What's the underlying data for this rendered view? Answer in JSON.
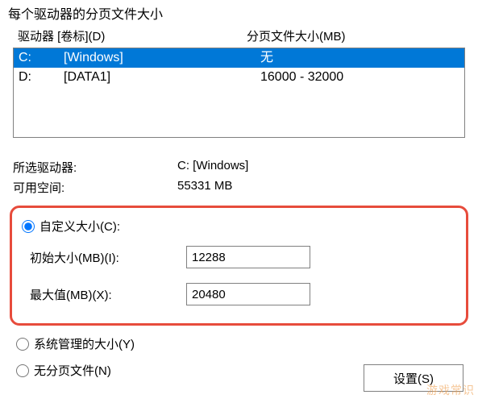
{
  "section_title": "每个驱动器的分页文件大小",
  "columns": {
    "drive": "驱动器 [卷标](D)",
    "pagefile": "分页文件大小(MB)"
  },
  "drives": [
    {
      "letter": "C:",
      "label": "[Windows]",
      "pagefile": "无",
      "selected": true
    },
    {
      "letter": "D:",
      "label": "[DATA1]",
      "pagefile": "16000 - 32000",
      "selected": false
    }
  ],
  "info": {
    "selected_drive_label": "所选驱动器:",
    "selected_drive_value": "C:  [Windows]",
    "free_space_label": "可用空间:",
    "free_space_value": "55331 MB"
  },
  "options": {
    "custom": {
      "label": "自定义大小(C):",
      "checked": true
    },
    "system": {
      "label": "系统管理的大小(Y)",
      "checked": false
    },
    "none": {
      "label": "无分页文件(N)",
      "checked": false
    }
  },
  "custom_fields": {
    "initial_label": "初始大小(MB)(I):",
    "initial_value": "12288",
    "max_label": "最大值(MB)(X):",
    "max_value": "20480"
  },
  "buttons": {
    "set": "设置(S)"
  },
  "watermark": "游戏常识"
}
